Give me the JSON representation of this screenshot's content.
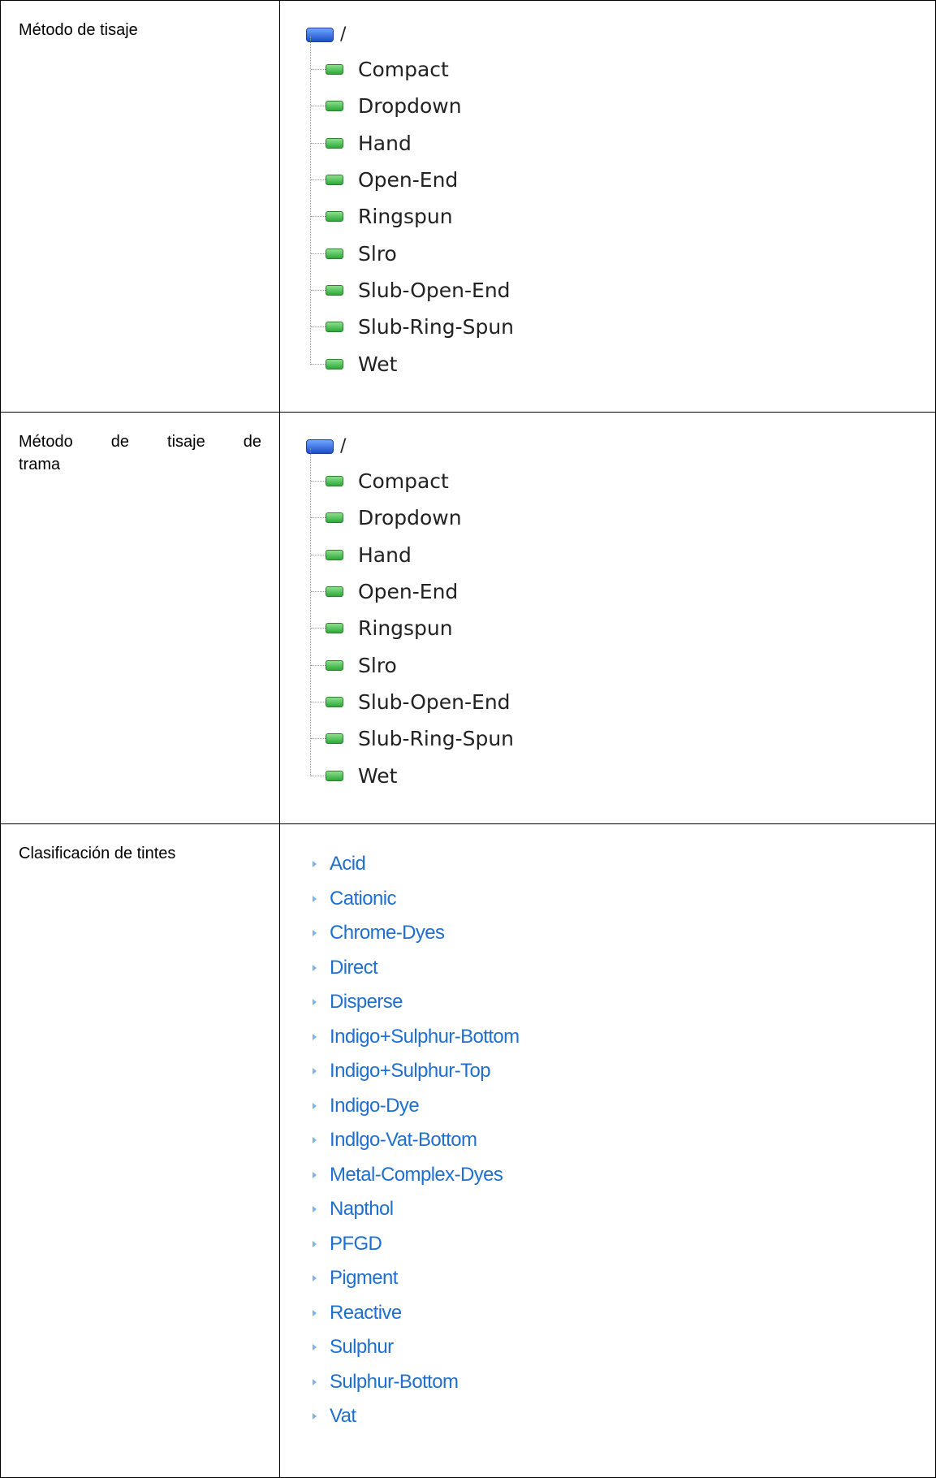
{
  "rows": [
    {
      "label": "Método de tisaje",
      "root": "/",
      "items": [
        "Compact",
        "Dropdown",
        "Hand",
        "Open-End",
        "Ringspun",
        "Slro",
        "Slub-Open-End",
        "Slub-Ring-Spun",
        "Wet"
      ]
    },
    {
      "label_line1": "Método de tisaje de",
      "label_line2": "trama",
      "root": "/",
      "items": [
        "Compact",
        "Dropdown",
        "Hand",
        "Open-End",
        "Ringspun",
        "Slro",
        "Slub-Open-End",
        "Slub-Ring-Spun",
        "Wet"
      ]
    },
    {
      "label": "Clasificación de tintes",
      "items": [
        "Acid",
        "Cationic",
        "Chrome-Dyes",
        "Direct",
        "Disperse",
        "Indigo+Sulphur-Bottom",
        "Indigo+Sulphur-Top",
        "Indigo-Dye",
        "Indlgo-Vat-Bottom",
        "Metal-Complex-Dyes",
        "Napthol",
        "PFGD",
        "Pigment",
        "Reactive",
        "Sulphur",
        "Sulphur-Bottom",
        "Vat"
      ]
    }
  ],
  "icons": {
    "root": "folder-icon",
    "leaf": "leaf-node-icon",
    "bullet": "arrow-bullet-icon"
  },
  "colors": {
    "link": "#1f6fd1",
    "folder": "#1c4fc8",
    "leaf": "#2fa83a"
  }
}
